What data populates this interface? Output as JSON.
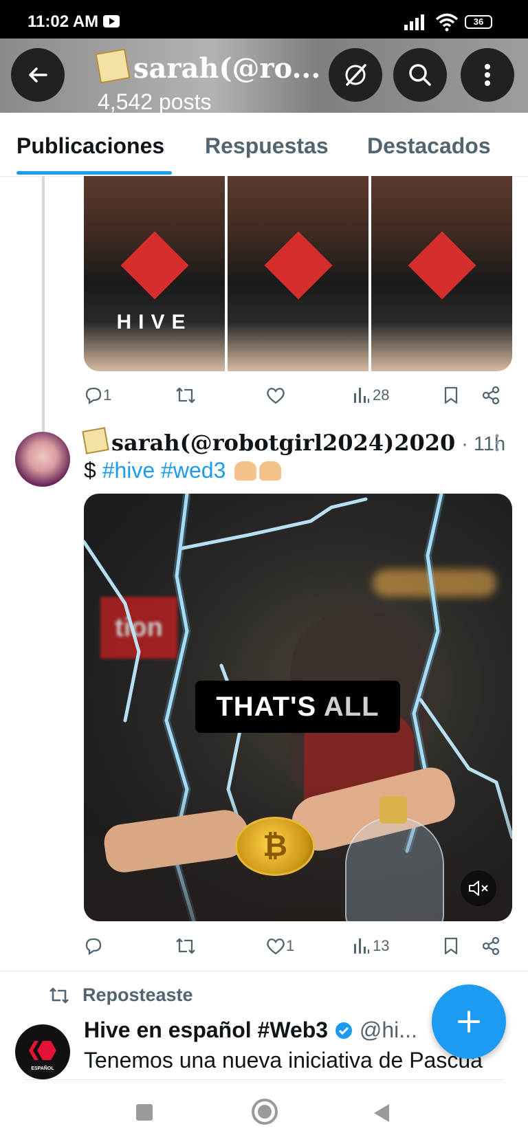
{
  "status_bar": {
    "time": "11:02 AM",
    "battery": "36"
  },
  "header": {
    "title": "sarah(@ro...",
    "posts_count": "4,542 posts"
  },
  "tabs": [
    {
      "label": "Publicaciones",
      "active": true
    },
    {
      "label": "Respuestas",
      "active": false
    },
    {
      "label": "Destacados",
      "active": false
    }
  ],
  "post1": {
    "image_tag_text": "HIVE",
    "actions": {
      "replies": "1",
      "reposts": "",
      "likes": "",
      "views": "28"
    }
  },
  "post2": {
    "name": "sarah(@robotgirl2024)2020",
    "time": "· 11h",
    "text_prefix": "$",
    "hashtags": [
      "#hive",
      "#wed3"
    ],
    "video": {
      "caption_main": "THAT'S ",
      "caption_dim": "ALL",
      "sign_text": "tion"
    },
    "actions": {
      "replies": "",
      "reposts": "",
      "likes": "1",
      "views": "13"
    }
  },
  "repost": {
    "label": "Reposteaste",
    "name": "Hive en español #Web3",
    "handle": "@hi...",
    "text": "Tenemos una nueva iniciativa de Pascua",
    "avatar_text": "ESPAÑOL"
  },
  "colors": {
    "accent": "#1d9bf0",
    "muted": "#536471",
    "text": "#0f1419",
    "hive_red": "#e31337"
  }
}
